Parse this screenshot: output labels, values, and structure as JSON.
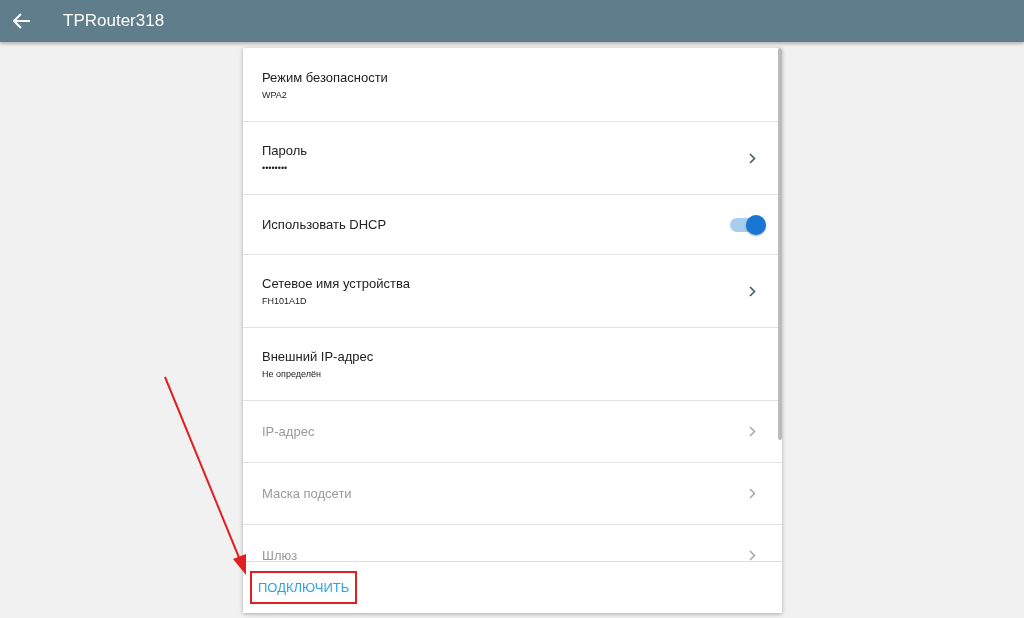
{
  "app_bar": {
    "title": "TPRouter318"
  },
  "settings": [
    {
      "kind": "detail",
      "title": "Режим безопасности",
      "subtitle": "WPA2",
      "chevron": false,
      "disabled": false
    },
    {
      "kind": "detail",
      "title": "Пароль",
      "subtitle": "••••••••",
      "chevron": true,
      "disabled": false
    },
    {
      "kind": "toggle",
      "title": "Использовать DHCP",
      "on": true,
      "disabled": false
    },
    {
      "kind": "detail",
      "title": "Сетевое имя устройства",
      "subtitle": "FH101A1D",
      "chevron": true,
      "disabled": false
    },
    {
      "kind": "detail",
      "title": "Внешний IP-адрес",
      "subtitle": "Не определён",
      "chevron": false,
      "disabled": false
    },
    {
      "kind": "detail",
      "title": "IP-адрес",
      "chevron": true,
      "disabled": true
    },
    {
      "kind": "detail",
      "title": "Маска подсети",
      "chevron": true,
      "disabled": true
    },
    {
      "kind": "detail",
      "title": "Шлюз",
      "chevron": true,
      "disabled": true
    }
  ],
  "action": {
    "label": "ПОДКЛЮЧИТЬ"
  },
  "annotation": {
    "arrow": true,
    "highlight": true
  }
}
